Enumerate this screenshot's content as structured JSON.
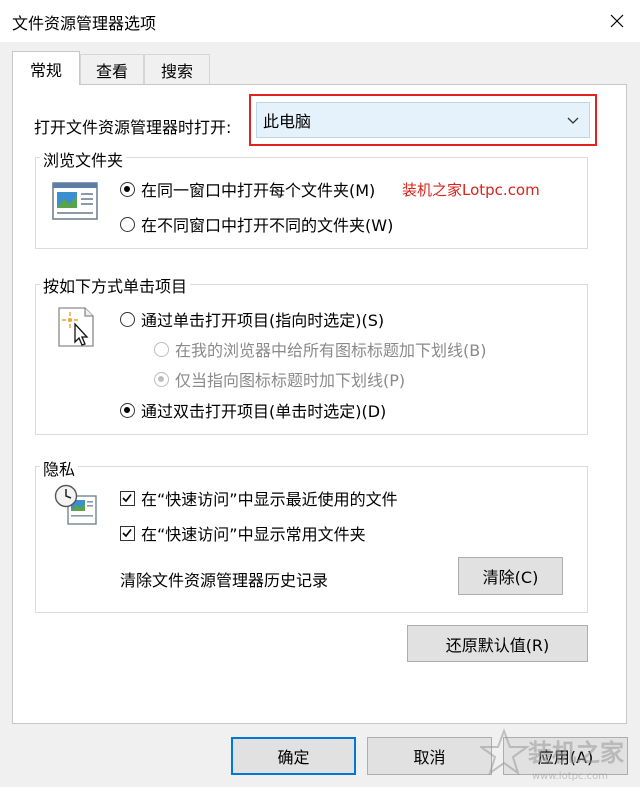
{
  "window": {
    "title": "文件资源管理器选项"
  },
  "tabs": [
    {
      "label": "常规",
      "active": true
    },
    {
      "label": "查看",
      "active": false
    },
    {
      "label": "搜索",
      "active": false
    }
  ],
  "general": {
    "open_label": "打开文件资源管理器时打开:",
    "open_value": "此电脑",
    "browse_group": {
      "legend": "浏览文件夹",
      "options": [
        {
          "label": "在同一窗口中打开每个文件夹(M)",
          "checked": true
        },
        {
          "label": "在不同窗口中打开不同的文件夹(W)",
          "checked": false
        }
      ]
    },
    "watermark_text": "装机之家Lotpc.com",
    "click_group": {
      "legend": "按如下方式单击项目",
      "single_click": "通过单击打开项目(指向时选定)(S)",
      "underline_all": "在我的浏览器中给所有图标标题加下划线(B)",
      "underline_hover": "仅当指向图标标题时加下划线(P)",
      "double_click": "通过双击打开项目(单击时选定)(D)"
    },
    "privacy_group": {
      "legend": "隐私",
      "recent_files": "在“快速访问”中显示最近使用的文件",
      "frequent_folders": "在“快速访问”中显示常用文件夹",
      "clear_history_label": "清除文件资源管理器历史记录",
      "clear_button": "清除(C)"
    },
    "restore_defaults": "还原默认值(R)"
  },
  "footer": {
    "ok": "确定",
    "cancel": "取消",
    "apply": "应用(A)"
  },
  "logo": {
    "text": "装机之家",
    "url_text": "www.lotpc.com"
  }
}
